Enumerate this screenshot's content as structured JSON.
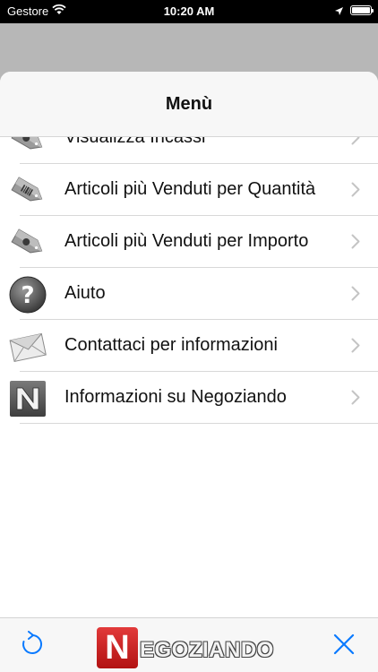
{
  "status_bar": {
    "carrier": "Gestore",
    "time": "10:20 AM",
    "wifi_icon": "wifi-icon",
    "location_icon": "location-arrow-icon",
    "battery_icon": "battery-icon"
  },
  "sheet": {
    "title": "Menù"
  },
  "menu": {
    "items": [
      {
        "label": "Visualizza Incassi",
        "icon": "price-tag-icon"
      },
      {
        "label": "Articoli più Venduti per Quantità",
        "icon": "price-tag-barcode-icon"
      },
      {
        "label": "Articoli più Venduti per Importo",
        "icon": "price-tag-icon"
      },
      {
        "label": "Aiuto",
        "icon": "help-icon"
      },
      {
        "label": "Contattaci per informazioni",
        "icon": "envelope-icon"
      },
      {
        "label": "Informazioni su Negoziando",
        "icon": "negoziando-n-icon"
      }
    ]
  },
  "bottom_bar": {
    "refresh_icon": "refresh-icon",
    "close_icon": "close-icon",
    "logo": {
      "initial": "N",
      "rest": "EGOZIANDO"
    }
  },
  "colors": {
    "accent": "#0a7aff",
    "backdrop": "#b7b7b7",
    "logo_red": "#c81e1e"
  }
}
